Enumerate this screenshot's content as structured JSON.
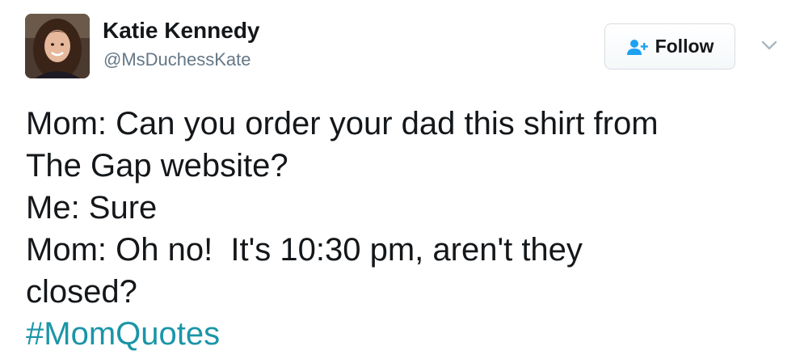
{
  "author": {
    "display_name": "Katie Kennedy",
    "handle": "@MsDuchessKate"
  },
  "actions": {
    "follow_label": "Follow",
    "follow_icon": "add-user-icon",
    "menu_icon": "chevron-down-icon"
  },
  "tweet": {
    "lines": [
      "Mom: Can you order your dad this shirt from",
      "The Gap website?",
      "Me: Sure",
      "Mom: Oh no!  It's 10:30 pm, aren't they",
      "closed?"
    ],
    "hashtag": "#MomQuotes"
  },
  "colors": {
    "hashtag": "#1b95a8",
    "text": "#14171a",
    "secondary": "#657786",
    "follow_icon": "#1da1f2"
  }
}
